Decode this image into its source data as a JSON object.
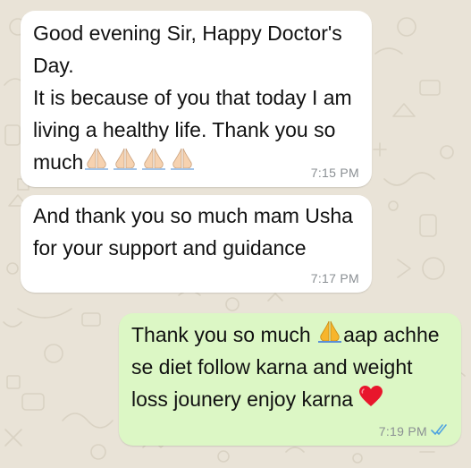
{
  "chat": {
    "messages": [
      {
        "direction": "incoming",
        "lines": [
          "Good evening Sir, Happy Doctor's",
          "Day.",
          "It is because of you that today I am",
          "living  a healthy life. Thank you so",
          "much"
        ],
        "trailing_emoji": [
          "folded-hands-icon",
          "folded-hands-icon",
          "folded-hands-icon",
          "folded-hands-icon"
        ],
        "time": "7:15 PM"
      },
      {
        "direction": "incoming",
        "lines": [
          "And thank you so much mam Usha",
          "for your support and guidance"
        ],
        "time": "7:17 PM"
      },
      {
        "direction": "outgoing",
        "lines": [
          "Thank you so much ",
          "aap achhe",
          "se diet follow karna and weight",
          "loss jounery enjoy karna "
        ],
        "inline_emoji": [
          "folded-hands-icon",
          "red-heart-icon"
        ],
        "time": "7:19 PM",
        "status": "read"
      }
    ]
  },
  "colors": {
    "wallpaper": "#e9e3d7",
    "incoming_bubble": "#ffffff",
    "outgoing_bubble": "#dcf7c5",
    "text": "#111111",
    "timestamp": "#8a8f93",
    "read_tick": "#4fa3e0",
    "heart": "#e8162c",
    "folded_hands_light": "#f6d2b0",
    "folded_hands_yellow": "#f7b52c"
  }
}
